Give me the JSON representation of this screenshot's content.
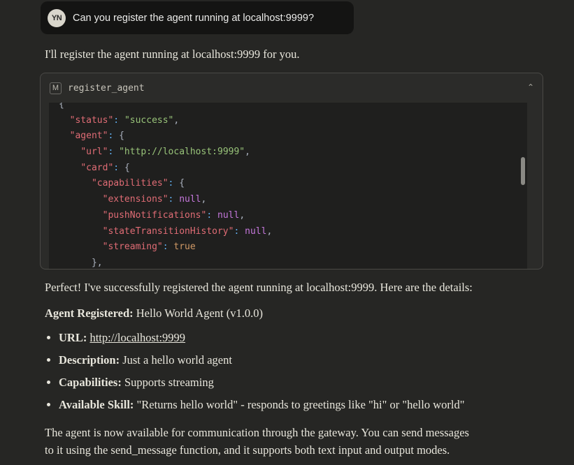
{
  "user_message": {
    "initials": "YN",
    "text": "Can you register the agent running at localhost:9999?"
  },
  "assistant_intro": "I'll register the agent running at localhost:9999 for you.",
  "tool_call": {
    "icon": "M",
    "name": "register_agent",
    "collapse_icon": "chevron-up-icon",
    "code_lines": [
      [
        {
          "t": "{",
          "c": "pn"
        }
      ],
      [
        {
          "t": "  "
        },
        {
          "t": "\"status\"",
          "c": "k"
        },
        {
          "t": ": ",
          "c": "c"
        },
        {
          "t": "\"success\"",
          "c": "s"
        },
        {
          "t": ",",
          "c": "pn"
        }
      ],
      [
        {
          "t": "  "
        },
        {
          "t": "\"agent\"",
          "c": "k"
        },
        {
          "t": ": ",
          "c": "c"
        },
        {
          "t": "{",
          "c": "pn"
        }
      ],
      [
        {
          "t": "    "
        },
        {
          "t": "\"url\"",
          "c": "k"
        },
        {
          "t": ": ",
          "c": "c"
        },
        {
          "t": "\"http://localhost:9999\"",
          "c": "s"
        },
        {
          "t": ",",
          "c": "pn"
        }
      ],
      [
        {
          "t": "    "
        },
        {
          "t": "\"card\"",
          "c": "k"
        },
        {
          "t": ": ",
          "c": "c"
        },
        {
          "t": "{",
          "c": "pn"
        }
      ],
      [
        {
          "t": "      "
        },
        {
          "t": "\"capabilities\"",
          "c": "k"
        },
        {
          "t": ": ",
          "c": "c"
        },
        {
          "t": "{",
          "c": "pn"
        }
      ],
      [
        {
          "t": "        "
        },
        {
          "t": "\"extensions\"",
          "c": "k"
        },
        {
          "t": ": ",
          "c": "c"
        },
        {
          "t": "null",
          "c": "n"
        },
        {
          "t": ",",
          "c": "pn"
        }
      ],
      [
        {
          "t": "        "
        },
        {
          "t": "\"pushNotifications\"",
          "c": "k"
        },
        {
          "t": ": ",
          "c": "c"
        },
        {
          "t": "null",
          "c": "n"
        },
        {
          "t": ",",
          "c": "pn"
        }
      ],
      [
        {
          "t": "        "
        },
        {
          "t": "\"stateTransitionHistory\"",
          "c": "k"
        },
        {
          "t": ": ",
          "c": "c"
        },
        {
          "t": "null",
          "c": "n"
        },
        {
          "t": ",",
          "c": "pn"
        }
      ],
      [
        {
          "t": "        "
        },
        {
          "t": "\"streaming\"",
          "c": "k"
        },
        {
          "t": ": ",
          "c": "c"
        },
        {
          "t": "true",
          "c": "b"
        }
      ],
      [
        {
          "t": "      "
        },
        {
          "t": "},",
          "c": "pn"
        }
      ]
    ]
  },
  "summary": "Perfect! I've successfully registered the agent running at localhost:9999. Here are the details:",
  "registered": {
    "label": "Agent Registered:",
    "value": " Hello World Agent (v1.0.0)"
  },
  "details": [
    {
      "label": "URL:",
      "value": "http://localhost:9999",
      "link": true
    },
    {
      "label": "Description:",
      "value": " Just a hello world agent"
    },
    {
      "label": "Capabilities:",
      "value": " Supports streaming"
    },
    {
      "label": "Available Skill:",
      "value": " \"Returns hello world\" - responds to greetings like \"hi\" or \"hello world\""
    }
  ],
  "closing": [
    "The agent is now available for communication through the gateway. You can send messages",
    "to it using the send_message function, and it supports both text input and output modes."
  ]
}
